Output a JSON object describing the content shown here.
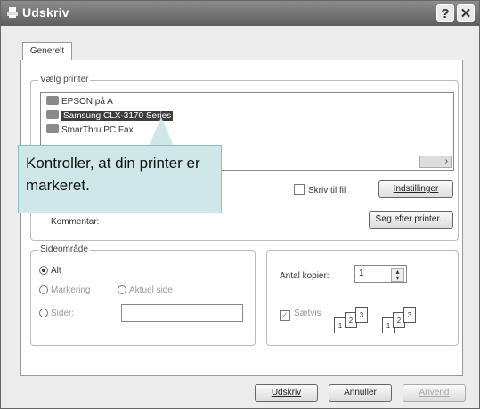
{
  "window": {
    "title": "Udskriv",
    "help_button": "?",
    "close_button": "✕"
  },
  "tabs": [
    {
      "label": "Generelt"
    }
  ],
  "printer_group": {
    "label": "Vælg printer",
    "printers": [
      {
        "name": "EPSON på A",
        "selected": false
      },
      {
        "name": "Samsung CLX-3170 Series",
        "selected": true
      },
      {
        "name": "SmarThru PC Fax",
        "selected": false
      }
    ],
    "print_to_file_label": "Skriv til fil",
    "print_to_file_checked": false,
    "settings_button": "Indstillinger",
    "comment_label": "Kommentar:",
    "find_printer_button": "Søg efter printer..."
  },
  "callout": {
    "text": "Kontroller, at din printer er markeret."
  },
  "page_range": {
    "label": "Sideområde",
    "all": "Alt",
    "selection": "Markering",
    "current_page": "Aktuel side",
    "pages": "Sider:",
    "pages_value": ""
  },
  "copies": {
    "count_label": "Antal kopier:",
    "count_value": "1",
    "collate_label": "Sætvis",
    "collate_checked": true
  },
  "footer": {
    "print_button": "Udskriv",
    "cancel_button": "Annuller",
    "apply_button": "Anvend"
  },
  "colors": {
    "titlebar": "#6e6e6e",
    "callout": "#cfe7e8",
    "selection": "#3d3d3d"
  }
}
